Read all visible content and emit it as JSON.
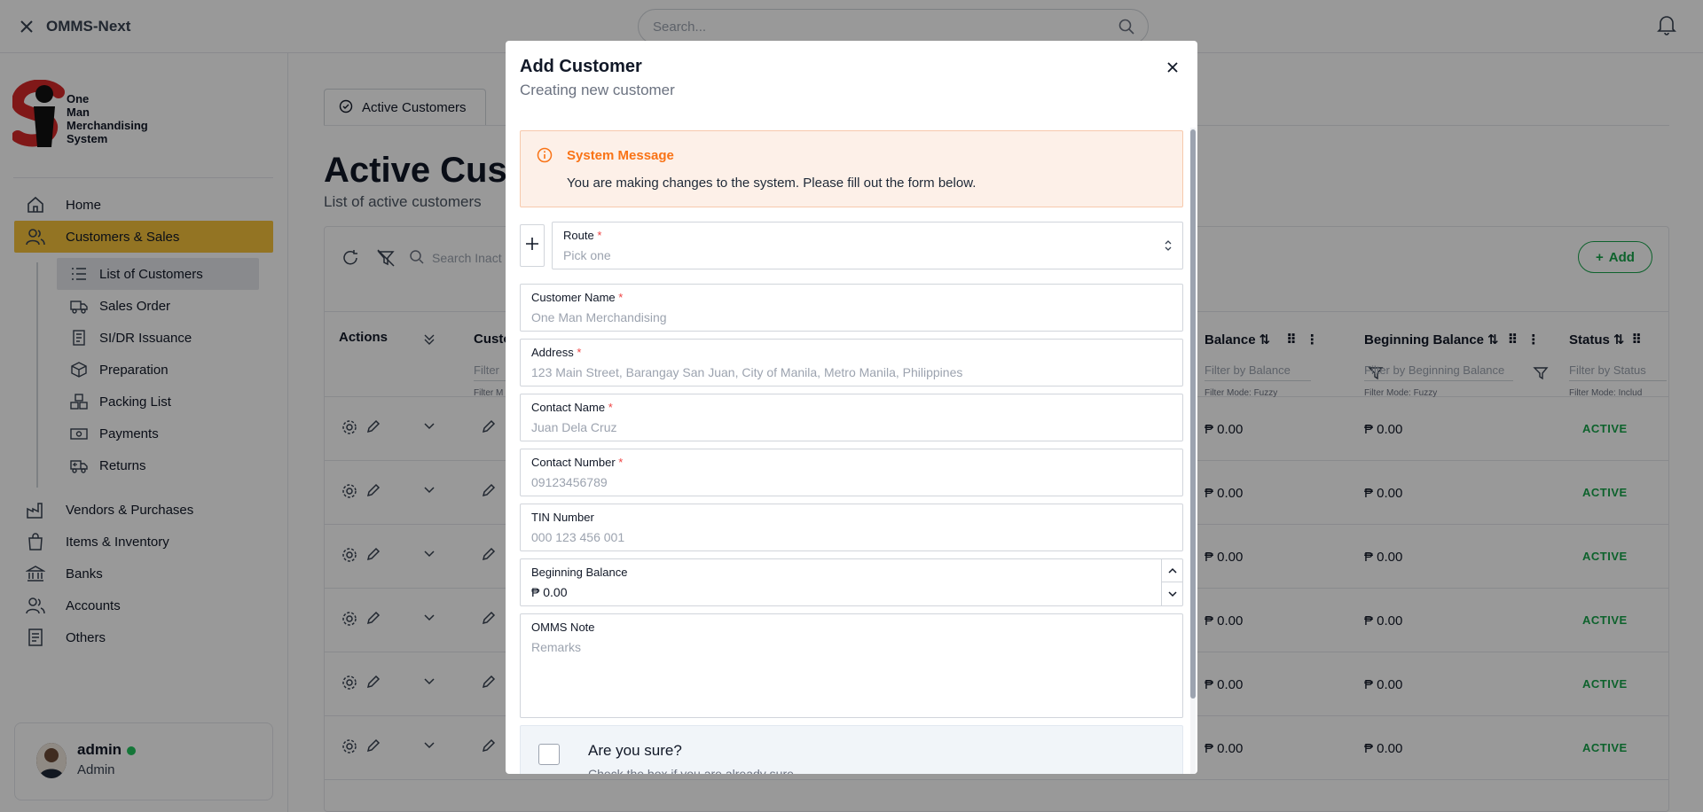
{
  "topbar": {
    "app_name": "OMMS-Next",
    "search_placeholder": "Search..."
  },
  "sidebar": {
    "logo_text": [
      "One",
      "Man",
      "Merchandising",
      "System"
    ],
    "nav": [
      {
        "label": "Home",
        "icon": "home-icon"
      },
      {
        "label": "Customers & Sales",
        "icon": "users-icon",
        "active": true
      },
      {
        "label": "Vendors & Purchases",
        "icon": "factory-icon"
      },
      {
        "label": "Items & Inventory",
        "icon": "shopping-bag-icon"
      },
      {
        "label": "Banks",
        "icon": "bank-icon"
      },
      {
        "label": "Accounts",
        "icon": "users-icon"
      },
      {
        "label": "Others",
        "icon": "document-icon"
      }
    ],
    "subnav": [
      {
        "label": "List of Customers",
        "icon": "list-icon",
        "active": true
      },
      {
        "label": "Sales Order",
        "icon": "truck-icon"
      },
      {
        "label": "SI/DR Issuance",
        "icon": "receipt-icon"
      },
      {
        "label": "Preparation",
        "icon": "box-icon"
      },
      {
        "label": "Packing List",
        "icon": "boxes-icon"
      },
      {
        "label": "Payments",
        "icon": "cash-icon"
      },
      {
        "label": "Returns",
        "icon": "return-truck-icon"
      }
    ],
    "user": {
      "name": "admin",
      "role": "Admin",
      "status_color": "#22c55e"
    }
  },
  "main": {
    "tab_active": "Active Customers",
    "title": "Active Cust",
    "subtitle": "List of active customers",
    "search_placeholder": "Search Inact",
    "add_label": "Add",
    "columns": {
      "actions": "Actions",
      "customer": "Custo",
      "customer_filter": "Filter",
      "customer_mode": "Filter M",
      "balance": "Balance",
      "balance_filter": "Filter by Balance",
      "balance_mode": "Filter Mode: Fuzzy",
      "beginning_balance": "Beginning Balance",
      "beginning_balance_filter": "Filter by Beginning Balance",
      "beginning_balance_mode": "Filter Mode: Fuzzy",
      "status": "Status",
      "status_filter": "Filter by Status",
      "status_mode": "Filter Mode: Includ"
    },
    "rows": [
      {
        "balance": "₱ 0.00",
        "beginning_balance": "₱ 0.00",
        "status": "ACTIVE"
      },
      {
        "balance": "₱ 0.00",
        "beginning_balance": "₱ 0.00",
        "status": "ACTIVE"
      },
      {
        "balance": "₱ 0.00",
        "beginning_balance": "₱ 0.00",
        "status": "ACTIVE"
      },
      {
        "balance": "₱ 0.00",
        "beginning_balance": "₱ 0.00",
        "status": "ACTIVE"
      },
      {
        "balance": "₱ 0.00",
        "beginning_balance": "₱ 0.00",
        "status": "ACTIVE"
      },
      {
        "balance": "₱ 0.00",
        "beginning_balance": "₱ 0.00",
        "status": "ACTIVE"
      }
    ]
  },
  "modal": {
    "title": "Add Customer",
    "subtitle": "Creating new customer",
    "system_message_title": "System Message",
    "system_message_body": "You are making changes to the system. Please fill out the form below.",
    "fields": {
      "route": {
        "label": "Route",
        "placeholder": "Pick one",
        "required": "*"
      },
      "customer_name": {
        "label": "Customer Name",
        "placeholder": "One Man Merchandising",
        "required": "*"
      },
      "address": {
        "label": "Address",
        "placeholder": "123 Main Street, Barangay San Juan, City of Manila, Metro Manila, Philippines",
        "required": "*"
      },
      "contact_name": {
        "label": "Contact Name",
        "placeholder": "Juan Dela Cruz",
        "required": "*"
      },
      "contact_number": {
        "label": "Contact Number",
        "placeholder": "09123456789",
        "required": "*"
      },
      "tin_number": {
        "label": "TIN Number",
        "placeholder": "000 123 456 001"
      },
      "beginning_balance": {
        "label": "Beginning Balance",
        "value": "₱ 0.00"
      },
      "omms_note": {
        "label": "OMMS Note",
        "placeholder": "Remarks"
      }
    },
    "confirm": {
      "title": "Are you sure?",
      "subtitle": "Check the box if you are already sure"
    }
  },
  "colors": {
    "accent": "#f5c23b",
    "success": "#16a34a",
    "warning": "#f97316",
    "required": "#ef4444"
  }
}
